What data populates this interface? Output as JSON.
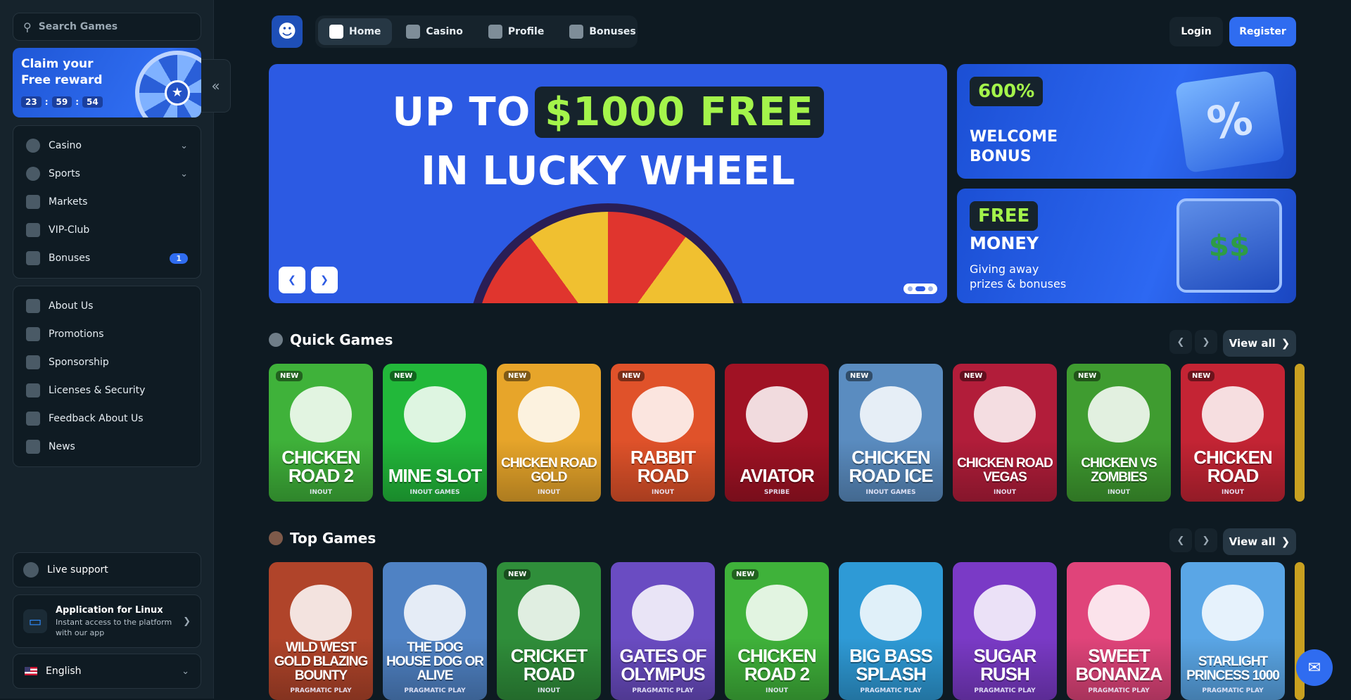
{
  "search": {
    "placeholder": "Search Games"
  },
  "claim": {
    "title_line1": "Claim your",
    "title_line2": "Free reward",
    "hours": "23",
    "minutes": "59",
    "seconds": "54"
  },
  "sidebar": {
    "nav1": [
      {
        "label": "Casino",
        "icon": "casino-chip-icon",
        "chevron": true
      },
      {
        "label": "Sports",
        "icon": "globe-ball-icon",
        "chevron": true
      },
      {
        "label": "Markets",
        "icon": "candlestick-icon"
      },
      {
        "label": "VIP-Club",
        "icon": "crown-icon"
      },
      {
        "label": "Bonuses",
        "icon": "gift-icon",
        "badge": "1"
      }
    ],
    "nav2": [
      {
        "label": "About Us",
        "icon": "book-icon"
      },
      {
        "label": "Promotions",
        "icon": "ticket-icon"
      },
      {
        "label": "Sponsorship",
        "icon": "medal-icon"
      },
      {
        "label": "Licenses & Security",
        "icon": "shield-icon"
      },
      {
        "label": "Feedback About Us",
        "icon": "chat-icon"
      },
      {
        "label": "News",
        "icon": "newspaper-icon"
      }
    ],
    "live_support": "Live support",
    "app": {
      "title": "Application for Linux",
      "desc_line1": "Instant access to the platform",
      "desc_line2": "with our app"
    },
    "language": "English"
  },
  "header": {
    "tabs": [
      {
        "label": "Home",
        "active": true
      },
      {
        "label": "Casino"
      },
      {
        "label": "Profile"
      },
      {
        "label": "Bonuses"
      }
    ],
    "login": "Login",
    "register": "Register"
  },
  "hero": {
    "line1_pre": "UP TO",
    "line1_highlight": "$1000 FREE",
    "line2": "IN LUCKY WHEEL",
    "slide_count": 3,
    "active_slide": 1
  },
  "promos": [
    {
      "pill": "600%",
      "title_line1": "WELCOME",
      "title_line2": "BONUS"
    },
    {
      "pill": "FREE",
      "title": "MONEY",
      "sub_line1": "Giving away",
      "sub_line2": "prizes & bonuses"
    }
  ],
  "quick_games": {
    "title": "Quick Games",
    "view_all": "View all",
    "games": [
      {
        "name": "CHICKEN ROAD 2",
        "provider": "INOUT",
        "new": true,
        "bg": "#3fb23a"
      },
      {
        "name": "MINE SLOT",
        "provider": "INOUT GAMES",
        "new": true,
        "bg": "#22b83a"
      },
      {
        "name": "CHICKEN ROAD GOLD",
        "provider": "INOUT",
        "new": true,
        "bg": "#e7a52a"
      },
      {
        "name": "RABBIT ROAD",
        "provider": "INOUT",
        "new": true,
        "bg": "#e0522a"
      },
      {
        "name": "AVIATOR",
        "provider": "SPRIBE",
        "new": false,
        "bg": "#a01224"
      },
      {
        "name": "CHICKEN ROAD ICE",
        "provider": "INOUT GAMES",
        "new": true,
        "bg": "#5a8cc0"
      },
      {
        "name": "CHICKEN ROAD VEGAS",
        "provider": "INOUT",
        "new": true,
        "bg": "#b21d3a"
      },
      {
        "name": "CHICKEN VS ZOMBIES",
        "provider": "INOUT",
        "new": true,
        "bg": "#3f9c30"
      },
      {
        "name": "CHICKEN ROAD",
        "provider": "INOUT",
        "new": true,
        "bg": "#c42434"
      }
    ]
  },
  "top_games": {
    "title": "Top Games",
    "view_all": "View all",
    "games": [
      {
        "name": "WILD WEST GOLD BLAZING BOUNTY",
        "provider": "PRAGMATIC PLAY",
        "new": false,
        "bg": "#b0442a"
      },
      {
        "name": "THE DOG HOUSE DOG OR ALIVE",
        "provider": "PRAGMATIC PLAY",
        "new": false,
        "bg": "#4f82c4"
      },
      {
        "name": "CRICKET ROAD",
        "provider": "INOUT",
        "new": true,
        "bg": "#2f8e3a"
      },
      {
        "name": "GATES OF OLYMPUS",
        "provider": "PRAGMATIC PLAY",
        "new": false,
        "bg": "#6a4cc2"
      },
      {
        "name": "CHICKEN ROAD 2",
        "provider": "INOUT",
        "new": true,
        "bg": "#3fb23a"
      },
      {
        "name": "BIG BASS SPLASH",
        "provider": "PRAGMATIC PLAY",
        "new": false,
        "bg": "#2e9ad6"
      },
      {
        "name": "SUGAR RUSH",
        "provider": "PRAGMATIC PLAY",
        "new": false,
        "bg": "#7a3ac6"
      },
      {
        "name": "SWEET BONANZA",
        "provider": "PRAGMATIC PLAY",
        "new": false,
        "bg": "#e0447a"
      },
      {
        "name": "STARLIGHT PRINCESS 1000",
        "provider": "PRAGMATIC PLAY",
        "new": false,
        "bg": "#5aa6e6"
      }
    ]
  },
  "new_badge": "NEW",
  "colors": {
    "accent": "#2f6cf0",
    "highlight": "#a4f44b",
    "bg": "#0e1a22"
  }
}
